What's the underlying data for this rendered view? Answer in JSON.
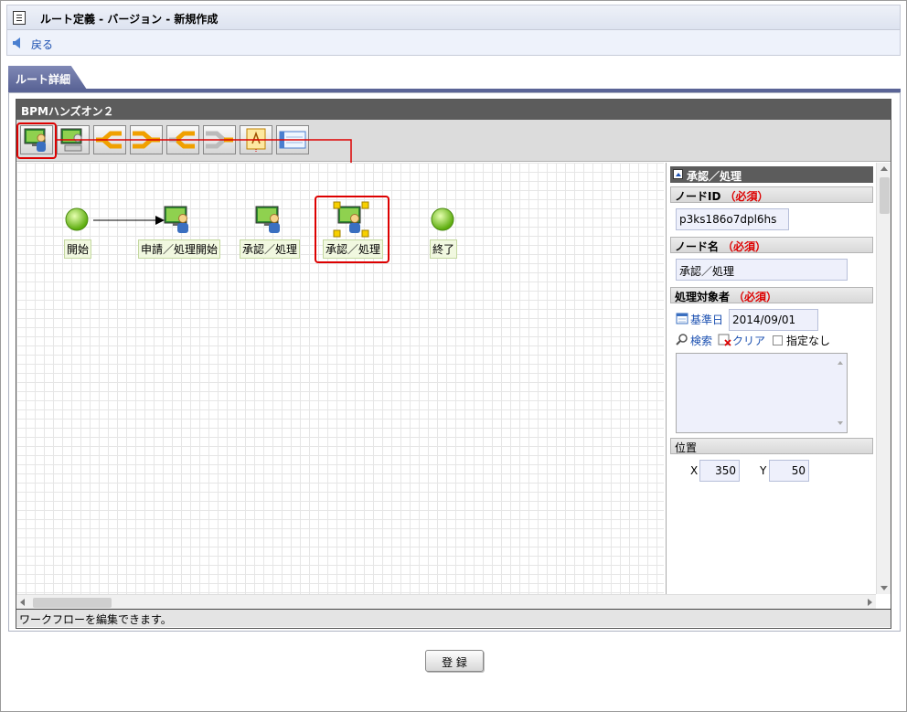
{
  "window": {
    "title": "ルート定義 - バージョン - 新規作成"
  },
  "nav": {
    "back_label": "戻る"
  },
  "tab": {
    "label": "ルート詳細"
  },
  "workflow": {
    "name": "BPMハンズオン２",
    "toolbar": [
      {
        "name": "user-task-tool",
        "icon": "user-monitor-icon",
        "selected": true
      },
      {
        "name": "system-task-tool",
        "icon": "system-monitor-icon"
      },
      {
        "name": "branch-start-tool",
        "icon": "branch-start-icon"
      },
      {
        "name": "branch-end-tool",
        "icon": "branch-end-icon"
      },
      {
        "name": "sub-branch-start-tool",
        "icon": "sub-branch-start-icon"
      },
      {
        "name": "sub-branch-end-tool",
        "icon": "sub-branch-end-icon"
      },
      {
        "name": "note-tool",
        "icon": "note-icon"
      },
      {
        "name": "panel-tool",
        "icon": "panel-icon"
      }
    ],
    "nodes": {
      "start": "開始",
      "apply": "申請／処理開始",
      "approve1": "承認／処理",
      "approve2": "承認／処理",
      "end": "終了"
    },
    "status": "ワークフローを編集できます。"
  },
  "props": {
    "title": "承認／処理",
    "node_id": {
      "label": "ノードID",
      "required": "（必須）",
      "value": "p3ks186o7dpl6hs"
    },
    "node_name": {
      "label": "ノード名",
      "required": "（必須）",
      "value": "承認／処理"
    },
    "target": {
      "label": "処理対象者",
      "required": "（必須）",
      "base_date_label": "基準日",
      "base_date": "2014/09/01",
      "search_label": "検索",
      "clear_label": "クリア",
      "none_label": "指定なし"
    },
    "position": {
      "label": "位置",
      "x_label": "X",
      "x_value": "350",
      "y_label": "Y",
      "y_value": "50"
    }
  },
  "submit_label": "登 録",
  "colors": {
    "accent": "#5a6496",
    "highlight": "#dd0000",
    "node_green": "#7fc400"
  }
}
